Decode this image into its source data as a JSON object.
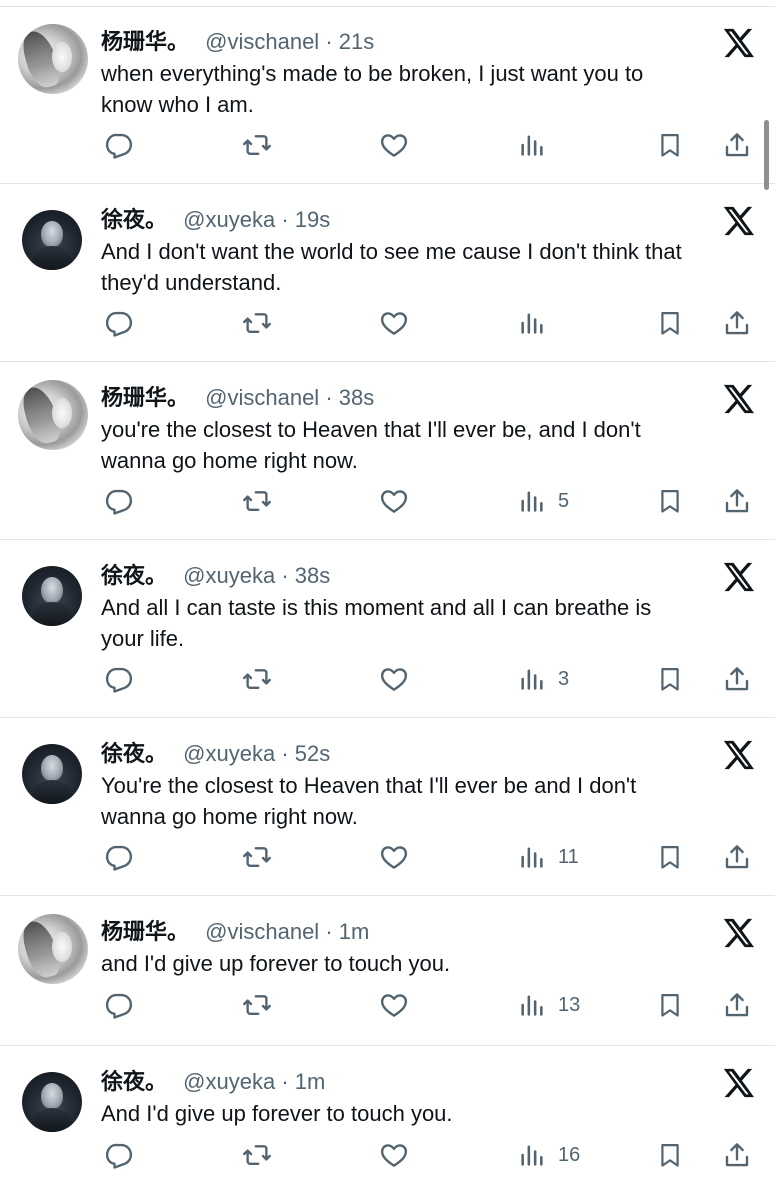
{
  "tweets": [
    {
      "avatar": "vischanel-avatar",
      "name": "杨珊华。",
      "handle": "@vischanel",
      "dot": "·",
      "time": "21s",
      "text": "when everything's made to be broken, I just want you to\nknow who I am.",
      "views": ""
    },
    {
      "avatar": "xuyeka-avatar",
      "name": "徐夜。",
      "handle": "@xuyeka",
      "dot": "·",
      "time": "19s",
      "text": "And I don't want the world to see me cause I don't think that\nthey'd understand.",
      "views": ""
    },
    {
      "avatar": "vischanel-avatar",
      "name": "杨珊华。",
      "handle": "@vischanel",
      "dot": "·",
      "time": "38s",
      "text": "you're the closest to Heaven that I'll ever be, and I don't\nwanna go home right now.",
      "views": "5"
    },
    {
      "avatar": "xuyeka-avatar",
      "name": "徐夜。",
      "handle": "@xuyeka",
      "dot": "·",
      "time": "38s",
      "text": "And all I can taste is this moment and all I can breathe is\nyour life.",
      "views": "3"
    },
    {
      "avatar": "xuyeka-avatar",
      "name": "徐夜。",
      "handle": "@xuyeka",
      "dot": "·",
      "time": "52s",
      "text": "You're the closest to Heaven that I'll ever be and I don't\nwanna go home right now.",
      "views": "11"
    },
    {
      "avatar": "vischanel-avatar",
      "name": "杨珊华。",
      "handle": "@vischanel",
      "dot": "·",
      "time": "1m",
      "text": "and I'd give up forever to touch you.",
      "views": "13"
    },
    {
      "avatar": "xuyeka-avatar",
      "name": "徐夜。",
      "handle": "@xuyeka",
      "dot": "·",
      "time": "1m",
      "text": "And I'd give up forever to touch you.",
      "views": "16"
    }
  ],
  "icons": {
    "platform": "x-logo-icon",
    "reply": "reply-icon",
    "repost": "repost-icon",
    "like": "like-icon",
    "views": "views-icon",
    "bookmark": "bookmark-icon",
    "share": "share-icon"
  },
  "colors": {
    "text": "#0f1419",
    "secondary": "#536471",
    "divider": "#e1e4e8",
    "background": "#ffffff"
  }
}
